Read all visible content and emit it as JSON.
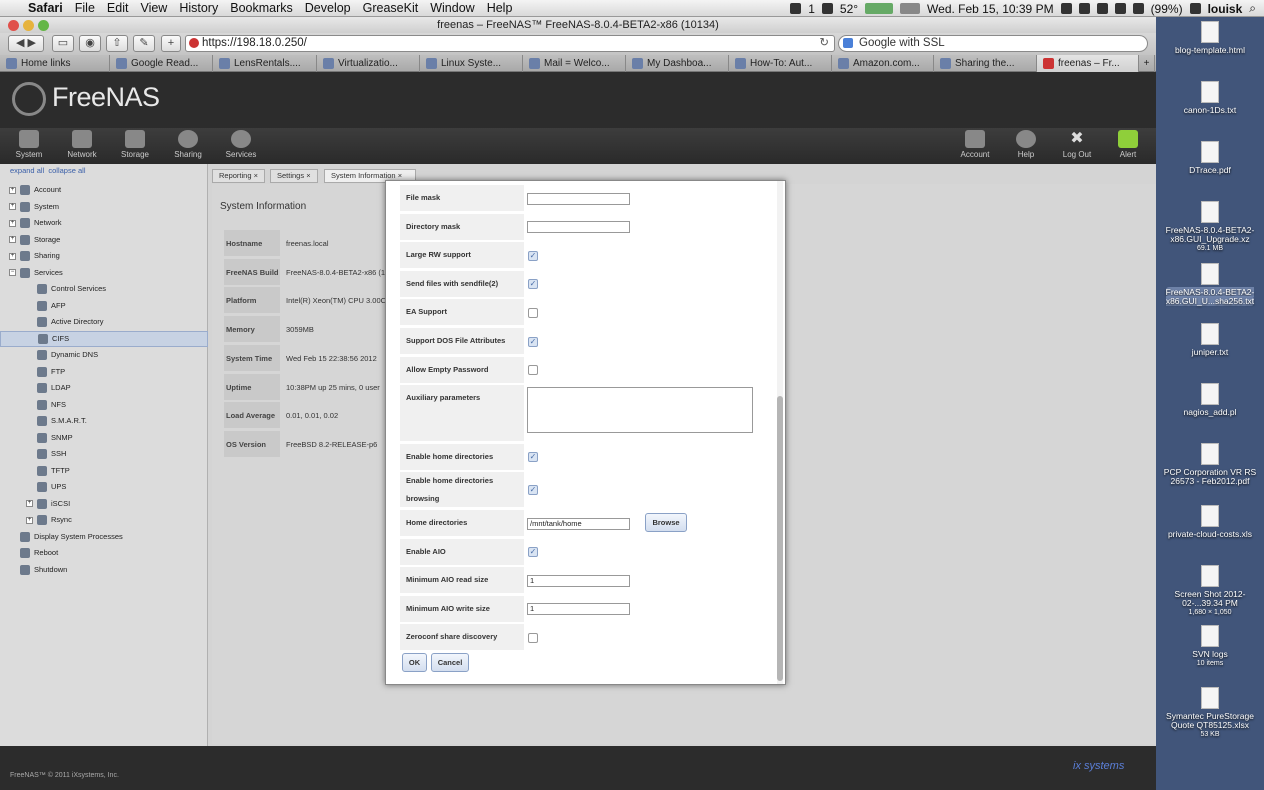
{
  "menubar": {
    "apple": "",
    "items": [
      "Safari",
      "File",
      "Edit",
      "View",
      "History",
      "Bookmarks",
      "Develop",
      "GreaseKit",
      "Window",
      "Help"
    ],
    "status": {
      "weather": "52°",
      "battery": "(99%)",
      "datetime": "Wed. Feb 15, 10:39 PM",
      "user": "louisk",
      "badge": "1"
    }
  },
  "window": {
    "title": "freenas – FreeNAS™ FreeNAS-8.0.4-BETA2-x86 (10134)",
    "url": "https://198.18.0.250/",
    "search_placeholder": "Google with SSL",
    "bookmarks": [
      "Home links",
      "Google Read...",
      "LensRentals....",
      "Virtualizatio...",
      "Linux Syste...",
      "Mail = Welco...",
      "My Dashboa...",
      "How-To: Aut...",
      "Amazon.com...",
      "Sharing the...",
      "freenas – Fr..."
    ]
  },
  "freenas": {
    "logo": "FreeNAS",
    "nav_left": [
      "System",
      "Network",
      "Storage",
      "Sharing",
      "Services"
    ],
    "nav_right": [
      "Account",
      "Help",
      "Log Out",
      "Alert"
    ],
    "expand_all": "expand all",
    "collapse_all": "collapse all",
    "tree": [
      {
        "label": "Account",
        "level": 0,
        "toggle": "+"
      },
      {
        "label": "System",
        "level": 0,
        "toggle": "+"
      },
      {
        "label": "Network",
        "level": 0,
        "toggle": "+"
      },
      {
        "label": "Storage",
        "level": 0,
        "toggle": "+"
      },
      {
        "label": "Sharing",
        "level": 0,
        "toggle": "+"
      },
      {
        "label": "Services",
        "level": 0,
        "toggle": "−"
      },
      {
        "label": "Control Services",
        "level": 1,
        "toggle": ""
      },
      {
        "label": "AFP",
        "level": 1,
        "toggle": ""
      },
      {
        "label": "Active Directory",
        "level": 1,
        "toggle": ""
      },
      {
        "label": "CIFS",
        "level": 1,
        "toggle": "",
        "selected": true
      },
      {
        "label": "Dynamic DNS",
        "level": 1,
        "toggle": ""
      },
      {
        "label": "FTP",
        "level": 1,
        "toggle": ""
      },
      {
        "label": "LDAP",
        "level": 1,
        "toggle": ""
      },
      {
        "label": "NFS",
        "level": 1,
        "toggle": ""
      },
      {
        "label": "S.M.A.R.T.",
        "level": 1,
        "toggle": ""
      },
      {
        "label": "SNMP",
        "level": 1,
        "toggle": ""
      },
      {
        "label": "SSH",
        "level": 1,
        "toggle": ""
      },
      {
        "label": "TFTP",
        "level": 1,
        "toggle": ""
      },
      {
        "label": "UPS",
        "level": 1,
        "toggle": ""
      },
      {
        "label": "iSCSI",
        "level": 1,
        "toggle": "+"
      },
      {
        "label": "Rsync",
        "level": 1,
        "toggle": "+"
      },
      {
        "label": "Display System Processes",
        "level": 0,
        "toggle": ""
      },
      {
        "label": "Reboot",
        "level": 0,
        "toggle": ""
      },
      {
        "label": "Shutdown",
        "level": 0,
        "toggle": ""
      }
    ],
    "tabs": [
      "Reporting",
      "Settings",
      "System Information"
    ],
    "sysinfo_title": "System Information",
    "sysinfo": [
      {
        "k": "Hostname",
        "v": "freenas.local"
      },
      {
        "k": "FreeNAS Build",
        "v": "FreeNAS-8.0.4-BETA2-x86 (1"
      },
      {
        "k": "Platform",
        "v": "Intel(R) Xeon(TM) CPU 3.00C"
      },
      {
        "k": "Memory",
        "v": "3059MB"
      },
      {
        "k": "System Time",
        "v": "Wed Feb 15 22:38:56 2012"
      },
      {
        "k": "Uptime",
        "v": "10:38PM up 25 mins, 0 user"
      },
      {
        "k": "Load Average",
        "v": "0.01, 0.01, 0.02"
      },
      {
        "k": "OS Version",
        "v": "FreeBSD 8.2-RELEASE-p6"
      }
    ],
    "footer_copy": "FreeNAS™ © 2011 iXsystems, Inc.",
    "footer_logo": "ix systems"
  },
  "modal": {
    "fields": [
      {
        "label": "File mask",
        "type": "text",
        "value": ""
      },
      {
        "label": "Directory mask",
        "type": "text",
        "value": ""
      },
      {
        "label": "Large RW support",
        "type": "checkbox",
        "checked": true
      },
      {
        "label": "Send files with sendfile(2)",
        "type": "checkbox",
        "checked": true
      },
      {
        "label": "EA Support",
        "type": "checkbox",
        "checked": false
      },
      {
        "label": "Support DOS File Attributes",
        "type": "checkbox",
        "checked": true
      },
      {
        "label": "Allow Empty Password",
        "type": "checkbox",
        "checked": false
      },
      {
        "label": "Auxiliary parameters",
        "type": "textarea",
        "value": ""
      },
      {
        "label": "Enable home directories",
        "type": "checkbox",
        "checked": true
      },
      {
        "label": "Enable home directories browsing",
        "type": "checkbox",
        "checked": true
      },
      {
        "label": "Home directories",
        "type": "text",
        "value": "/mnt/tank/home",
        "button": "Browse"
      },
      {
        "label": "Enable AIO",
        "type": "checkbox",
        "checked": true
      },
      {
        "label": "Minimum AIO read size",
        "type": "text",
        "value": "1"
      },
      {
        "label": "Minimum AIO write size",
        "type": "text",
        "value": "1"
      },
      {
        "label": "Zeroconf share discovery",
        "type": "checkbox",
        "checked": false
      }
    ],
    "ok": "OK",
    "cancel": "Cancel"
  },
  "desktop": [
    {
      "name": "blog-template.html",
      "sub": ""
    },
    {
      "name": "canon-1Ds.txt",
      "sub": ""
    },
    {
      "name": "DTrace.pdf",
      "sub": ""
    },
    {
      "name": "FreeNAS-8.0.4-BETA2-x86.GUI_Upgrade.xz",
      "sub": "69.1 MB"
    },
    {
      "name": "FreeNAS-8.0.4-BETA2-x86.GUI_U...sha256.txt",
      "sub": "",
      "selected": true
    },
    {
      "name": "juniper.txt",
      "sub": ""
    },
    {
      "name": "nagios_add.pl",
      "sub": ""
    },
    {
      "name": "PCP Corporation VR RS 26573 - Feb2012.pdf",
      "sub": ""
    },
    {
      "name": "private-cloud-costs.xls",
      "sub": ""
    },
    {
      "name": "Screen Shot 2012-02-...39.34 PM",
      "sub": "1,680 × 1,050"
    },
    {
      "name": "SVN logs",
      "sub": "10 items"
    },
    {
      "name": "Symantec PureStorage Quote QT85125.xlsx",
      "sub": "53 KB"
    }
  ]
}
